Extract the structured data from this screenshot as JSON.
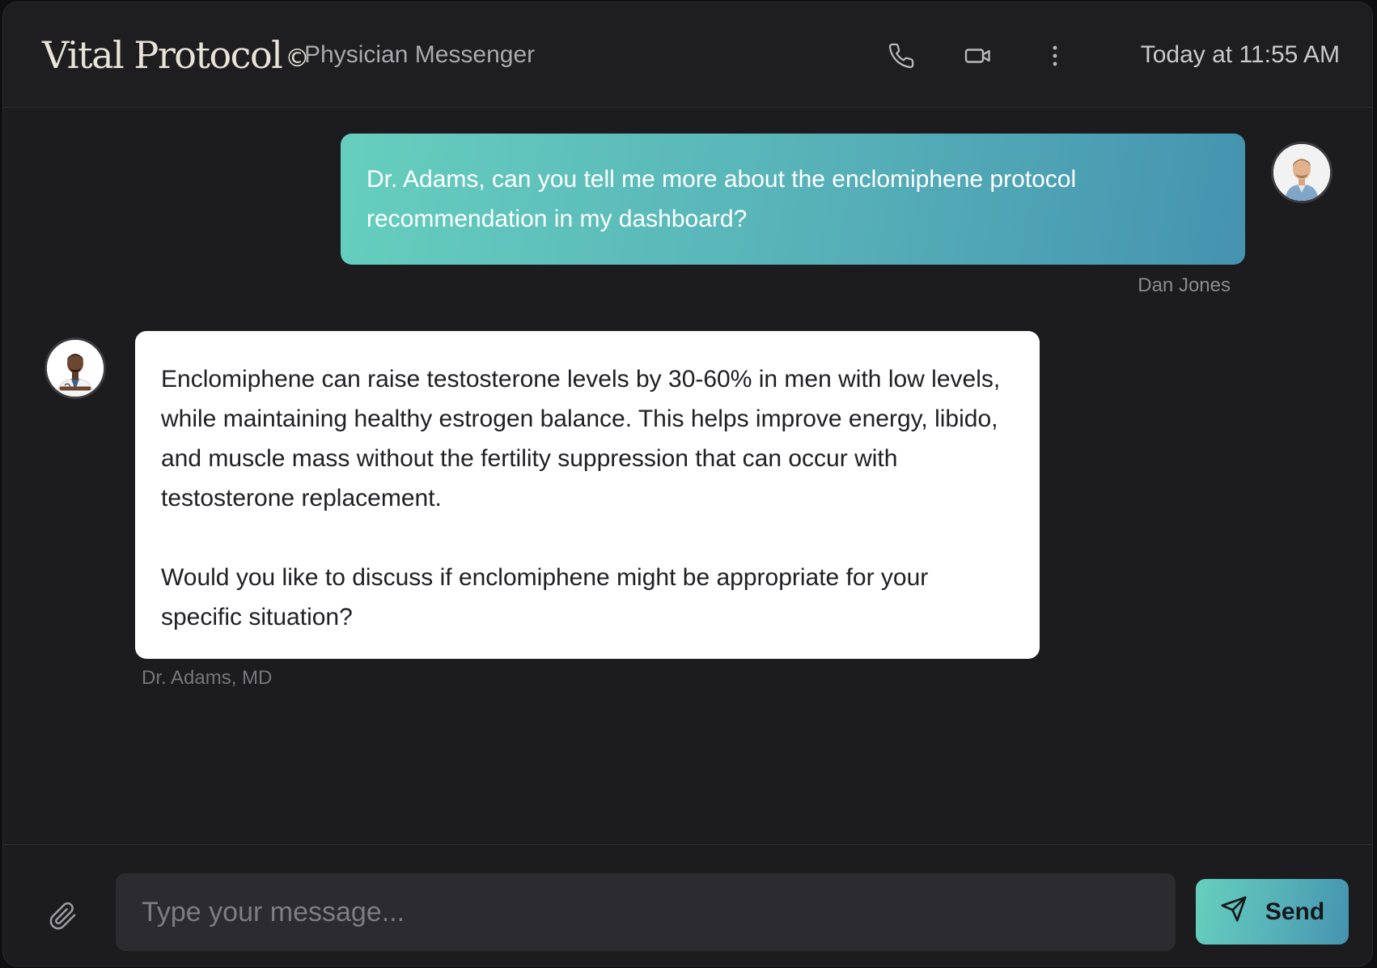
{
  "header": {
    "brand": "Vital Protocol",
    "brand_mark": "©",
    "subtitle": "Physician Messenger",
    "timestamp": "Today at 11:55 AM",
    "icons": [
      "phone-icon",
      "video-camera-icon",
      "more-vertical-icon"
    ]
  },
  "messages": [
    {
      "sender": "Dan Jones",
      "role": "patient",
      "paragraphs": [
        "Dr. Adams, can you tell me more about the enclomiphene protocol recommendation in my dashboard?"
      ]
    },
    {
      "sender": "Dr. Adams, MD",
      "role": "physician",
      "paragraphs": [
        "Enclomiphene can raise testosterone levels by 30-60% in men with low levels, while maintaining healthy estrogen balance. This helps improve energy, libido, and muscle mass without the fertility suppression that can occur with testosterone replacement.",
        "Would you like to discuss if enclomiphene might be appropriate for your specific situation?"
      ]
    }
  ],
  "composer": {
    "placeholder": "Type your message...",
    "value": "",
    "send_label": "Send",
    "attach_icon": "paperclip-icon",
    "send_icon": "send-icon"
  },
  "colors": {
    "accent_start": "#66cfbe",
    "accent_end": "#4593b0",
    "background": "#1c1c1f"
  }
}
